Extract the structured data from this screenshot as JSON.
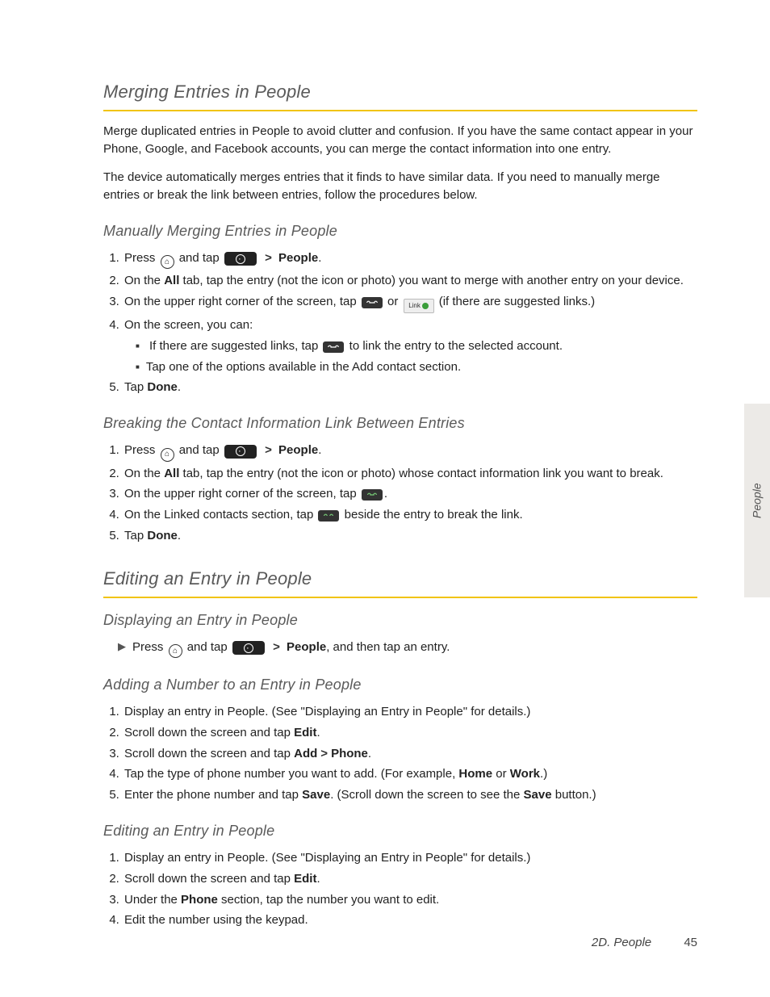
{
  "side_tab": "People",
  "footer": {
    "section": "2D. People",
    "page": "45"
  },
  "s1": {
    "title": "Merging Entries in People",
    "p1": "Merge duplicated entries in People to avoid clutter and confusion. If you have the same contact appear in your Phone, Google, and Facebook accounts, you can merge the contact information into one entry.",
    "p2": "The device automatically merges entries that it finds to have similar data. If you need to manually merge entries or break the link between entries, follow the procedures below.",
    "sub1": {
      "title": "Manually Merging Entries in People",
      "step1_a": "Press ",
      "step1_b": " and tap ",
      "step1_people": "People",
      "step1_dot": ".",
      "step2_a": "On the ",
      "step2_all": "All",
      "step2_b": " tab, tap the entry (not the icon or photo) you want to merge with another entry on your device.",
      "step3_a": "On the upper right corner of the screen, tap ",
      "step3_or": " or ",
      "step3_b": " (if there are suggested links.)",
      "step4": "On the screen, you can:",
      "sub_a1": "If there are suggested links, tap ",
      "sub_a2": " to link the entry to the selected account.",
      "sub_b": "Tap one of the options available in the Add contact section.",
      "step5_a": "Tap ",
      "step5_done": "Done",
      "step5_dot": "."
    },
    "sub2": {
      "title": "Breaking the Contact Information Link Between Entries",
      "step1_a": "Press ",
      "step1_b": " and tap ",
      "step1_people": "People",
      "step1_dot": ".",
      "step2_a": "On the ",
      "step2_all": "All",
      "step2_b": " tab, tap the entry (not the icon or photo) whose contact information link you want to break.",
      "step3_a": "On the upper right corner of the screen, tap ",
      "step3_dot": ".",
      "step4_a": "On the Linked contacts section, tap ",
      "step4_b": " beside the entry to break the link.",
      "step5_a": "Tap ",
      "step5_done": "Done",
      "step5_dot": "."
    }
  },
  "s2": {
    "title": "Editing an Entry in People",
    "sub1": {
      "title": "Displaying an Entry in People",
      "l_a": "Press ",
      "l_b": " and tap ",
      "l_people": "People",
      "l_c": ", and then tap an entry."
    },
    "sub2": {
      "title": "Adding a Number to an Entry in People",
      "step1": "Display an entry in People. (See \"Displaying an Entry in People\" for details.)",
      "step2_a": "Scroll down the screen and tap ",
      "step2_edit": "Edit",
      "step2_dot": ".",
      "step3_a": "Scroll down the screen and tap ",
      "step3_add": "Add",
      "step3_phone": "Phone",
      "step3_dot": ".",
      "step4_a": "Tap the type of phone number you want to add. (For example, ",
      "step4_home": "Home",
      "step4_or": " or ",
      "step4_work": "Work",
      "step4_b": ".)",
      "step5_a": "Enter the phone number and tap ",
      "step5_save": "Save",
      "step5_b": ". (Scroll down the screen to see the ",
      "step5_save2": "Save",
      "step5_c": " button.)"
    },
    "sub3": {
      "title": "Editing an Entry in People",
      "step1": "Display an entry in People. (See \"Displaying an Entry in People\" for details.)",
      "step2_a": "Scroll down the screen and tap ",
      "step2_edit": "Edit",
      "step2_dot": ".",
      "step3_a": "Under the ",
      "step3_phone": "Phone",
      "step3_b": " section, tap the number you want to edit.",
      "step4": "Edit the number using the keypad."
    }
  }
}
